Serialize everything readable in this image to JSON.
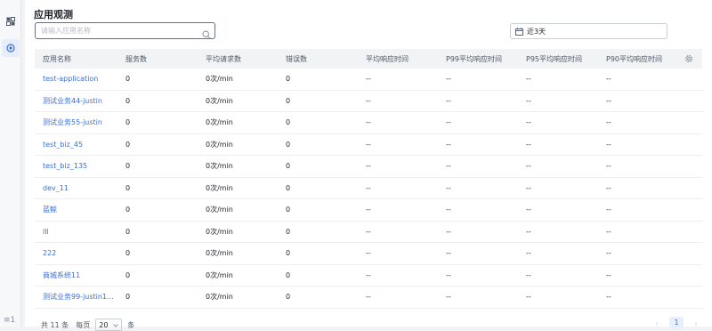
{
  "page_title": "应用观测",
  "search": {
    "placeholder": "请输入应用名称",
    "value": ""
  },
  "date_range": {
    "label": "近3天"
  },
  "table": {
    "headers": [
      "应用名称",
      "服务数",
      "平均请求数",
      "错误数",
      "平均响应时间",
      "P99平均响应时间",
      "P95平均响应时间",
      "P90平均响应时间"
    ],
    "rows": [
      {
        "name": "test-application",
        "services": "0",
        "avg_requests": "0次/min",
        "errors": "0",
        "avg_resp": "--",
        "p99": "--",
        "p95": "--",
        "p90": "--"
      },
      {
        "name": "测试业务44-justin",
        "services": "0",
        "avg_requests": "0次/min",
        "errors": "0",
        "avg_resp": "--",
        "p99": "--",
        "p95": "--",
        "p90": "--"
      },
      {
        "name": "测试业务55-justin",
        "services": "0",
        "avg_requests": "0次/min",
        "errors": "0",
        "avg_resp": "--",
        "p99": "--",
        "p95": "--",
        "p90": "--"
      },
      {
        "name": "test_biz_45",
        "services": "0",
        "avg_requests": "0次/min",
        "errors": "0",
        "avg_resp": "--",
        "p99": "--",
        "p95": "--",
        "p90": "--"
      },
      {
        "name": "test_biz_135",
        "services": "0",
        "avg_requests": "0次/min",
        "errors": "0",
        "avg_resp": "--",
        "p99": "--",
        "p95": "--",
        "p90": "--"
      },
      {
        "name": "dev_11",
        "services": "0",
        "avg_requests": "0次/min",
        "errors": "0",
        "avg_resp": "--",
        "p99": "--",
        "p95": "--",
        "p90": "--"
      },
      {
        "name": "蓝鲸",
        "services": "0",
        "avg_requests": "0次/min",
        "errors": "0",
        "avg_resp": "--",
        "p99": "--",
        "p95": "--",
        "p90": "--"
      },
      {
        "name": "lll",
        "services": "0",
        "avg_requests": "0次/min",
        "errors": "0",
        "avg_resp": "--",
        "p99": "--",
        "p95": "--",
        "p90": "--"
      },
      {
        "name": "222",
        "services": "0",
        "avg_requests": "0次/min",
        "errors": "0",
        "avg_resp": "--",
        "p99": "--",
        "p95": "--",
        "p90": "--"
      },
      {
        "name": "商城系统11",
        "services": "0",
        "avg_requests": "0次/min",
        "errors": "0",
        "avg_resp": "--",
        "p99": "--",
        "p95": "--",
        "p90": "--"
      },
      {
        "name": "测试业务99-justin1...",
        "services": "0",
        "avg_requests": "0次/min",
        "errors": "0",
        "avg_resp": "--",
        "p99": "--",
        "p95": "--",
        "p90": "--"
      }
    ]
  },
  "pagination": {
    "total_label": "共 11 条",
    "per_page_label": "每页",
    "page_size": "20",
    "unit_label": "条",
    "prev": "‹",
    "current_page": "1",
    "next": "›"
  },
  "sidebar": {
    "footer": "≡1"
  },
  "icons": {
    "apps": "apps-icon",
    "observe": "observe-icon",
    "search": "search-icon",
    "calendar": "calendar-icon",
    "settings": "gear-icon",
    "dropdown": "chevron-down-icon"
  },
  "colors": {
    "accent": "#3a6fd8",
    "header_bg": "#f2f3f5",
    "active_bg": "#e6eefc"
  }
}
